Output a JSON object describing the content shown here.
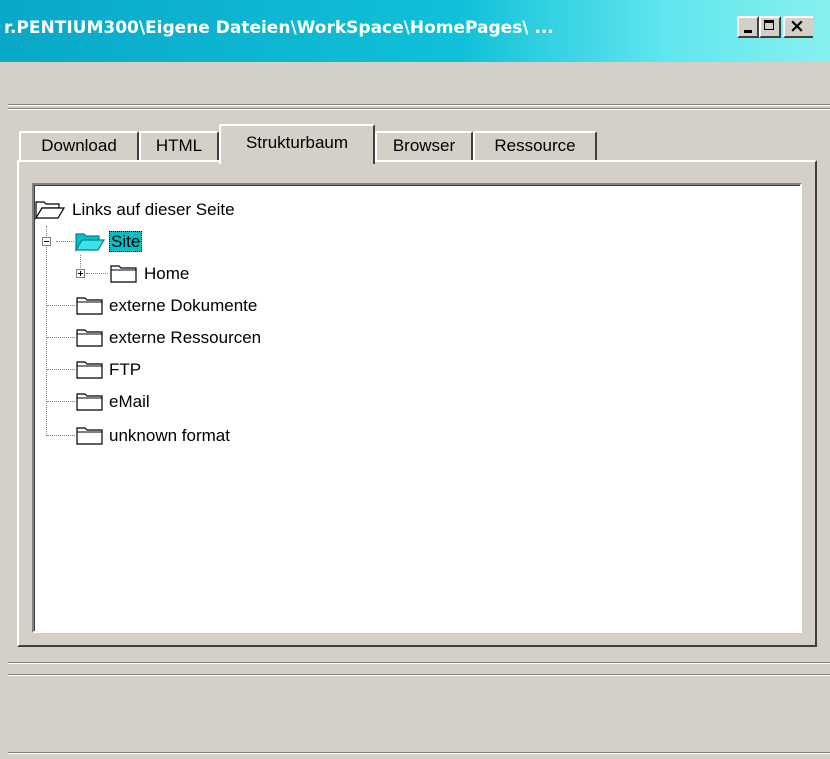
{
  "window": {
    "title": "r.PENTIUM300\\Eigene Dateien\\WorkSpace\\HomePages\\ ...",
    "controls": {
      "minimize": "_",
      "maximize": "□",
      "close": "✕"
    }
  },
  "tabs": [
    {
      "label": "Download",
      "active": false
    },
    {
      "label": "HTML",
      "active": false
    },
    {
      "label": "Strukturbaum",
      "active": true
    },
    {
      "label": "Browser",
      "active": false
    },
    {
      "label": "Ressource",
      "active": false
    }
  ],
  "tree": {
    "root": {
      "label": "Links auf dieser Seite",
      "icon": "open-folder-icon"
    },
    "site": {
      "label": "Site",
      "icon": "open-folder-icon",
      "expanded": true,
      "selected": true,
      "color": "#00c0c8"
    },
    "home": {
      "label": "Home",
      "icon": "folder-icon",
      "expanded": false
    },
    "items": [
      {
        "label": "externe Dokumente",
        "icon": "folder-icon"
      },
      {
        "label": "externe Ressourcen",
        "icon": "folder-icon"
      },
      {
        "label": "FTP",
        "icon": "folder-icon"
      },
      {
        "label": "eMail",
        "icon": "folder-icon"
      },
      {
        "label": "unknown format",
        "icon": "folder-icon"
      }
    ]
  },
  "colors": {
    "face": "#d4d0c8",
    "titlebar_start": "#0aa8c8",
    "titlebar_end": "#88f0f0",
    "selection": "#00c0c8"
  }
}
